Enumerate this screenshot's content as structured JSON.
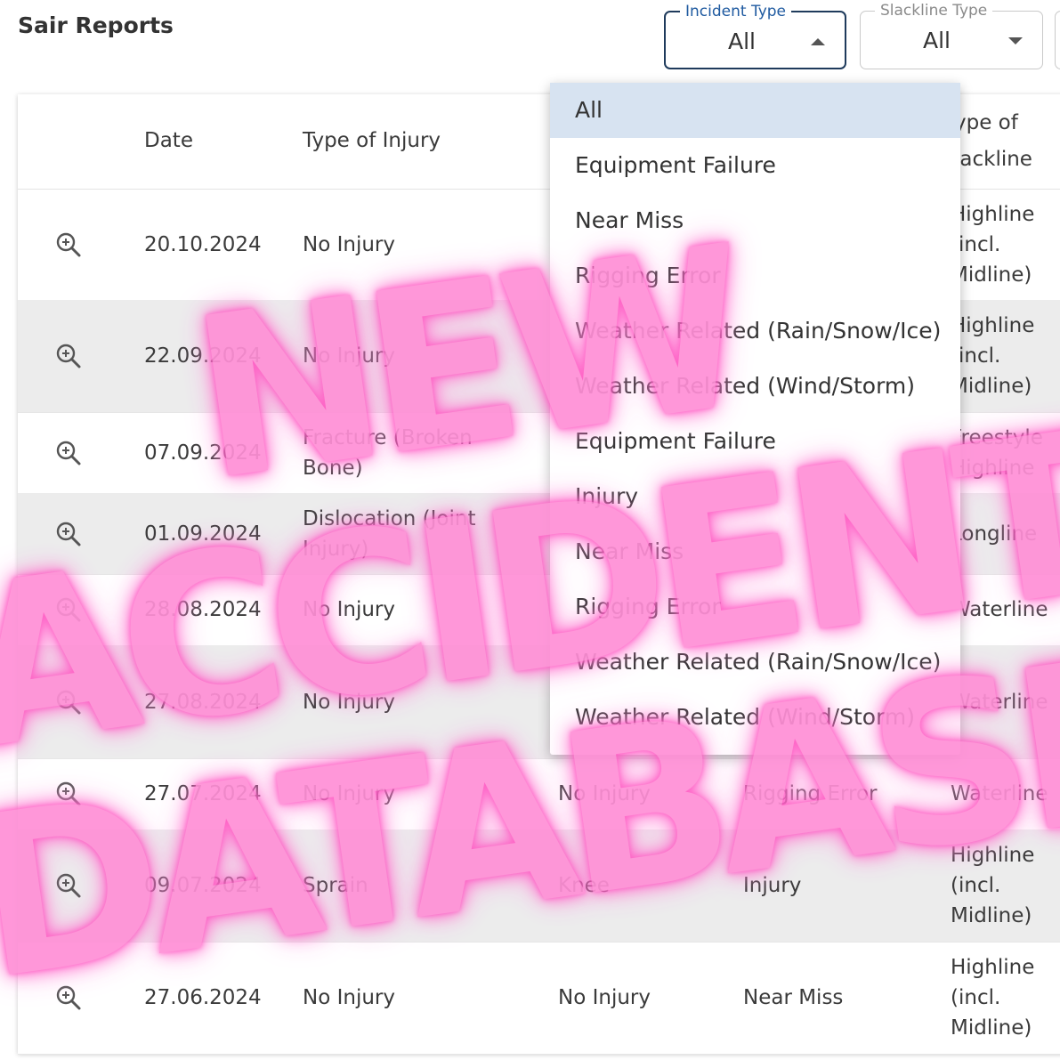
{
  "header": {
    "title": "Sair Reports"
  },
  "filters": {
    "incident_type": {
      "label": "Incident Type",
      "value": "All"
    },
    "slackline_type": {
      "label": "Slackline Type",
      "value": "All"
    }
  },
  "table": {
    "columns": [
      "Date",
      "Type of Injury",
      "Type of Slackline"
    ],
    "col_col_slackline_lines": [
      "ype of",
      "lackline"
    ],
    "rows": [
      {
        "date": "20.10.2024",
        "injury": "No Injury",
        "c3": "",
        "c4": "",
        "slackline": [
          "Highline",
          "(incl.",
          "Midline)"
        ]
      },
      {
        "date": "22.09.2024",
        "injury": "No Injury",
        "c3": "",
        "c4": "",
        "slackline": [
          "Highline",
          "(incl.",
          "Midline)"
        ]
      },
      {
        "date": "07.09.2024",
        "injury": "Fracture (Broken Bone)",
        "c3": "",
        "c4": "",
        "slackline": [
          "Freestyle",
          "Highline"
        ]
      },
      {
        "date": "01.09.2024",
        "injury": "Dislocation (Joint Injury)",
        "c3": "",
        "c4": "",
        "slackline": [
          "Longline"
        ]
      },
      {
        "date": "28.08.2024",
        "injury": "No Injury",
        "c3": "",
        "c4": "",
        "slackline": [
          "Waterline"
        ]
      },
      {
        "date": "27.08.2024",
        "injury": "No Injury",
        "c3": "",
        "c4": "",
        "slackline": [
          "Waterline"
        ]
      },
      {
        "date": "27.07.2024",
        "injury": "No Injury",
        "c3": "No Injury",
        "c4": "Rigging Error",
        "slackline": [
          "Waterline"
        ]
      },
      {
        "date": "09.07.2024",
        "injury": "Sprain",
        "c3": "Knee",
        "c4": "Injury",
        "slackline": [
          "Highline",
          "(incl.",
          "Midline)"
        ]
      },
      {
        "date": "27.06.2024",
        "injury": "No Injury",
        "c3": "No Injury",
        "c4": "Near Miss",
        "slackline": [
          "Highline",
          "(incl.",
          "Midline)"
        ]
      }
    ]
  },
  "dropdown": {
    "items": [
      "All",
      "Equipment Failure",
      "Near Miss",
      "Rigging Error",
      "Weather Related (Rain/Snow/Ice)",
      "Weather Related (Wind/Storm)",
      "Equipment Failure",
      "Injury",
      "Near Miss",
      "Rigging Error",
      "Weather Related (Rain/Snow/Ice)",
      "Weather Related (Wind/Storm)"
    ],
    "selected": "All"
  },
  "overlay": {
    "lines": [
      "NEW",
      "ACCIDENT",
      "DATABASE"
    ],
    "color": "#ff8fd6"
  },
  "icons": {
    "row_action": "zoom-in-icon",
    "filter_caret_open": "caret-up-icon",
    "filter_caret_closed": "caret-down-icon"
  }
}
